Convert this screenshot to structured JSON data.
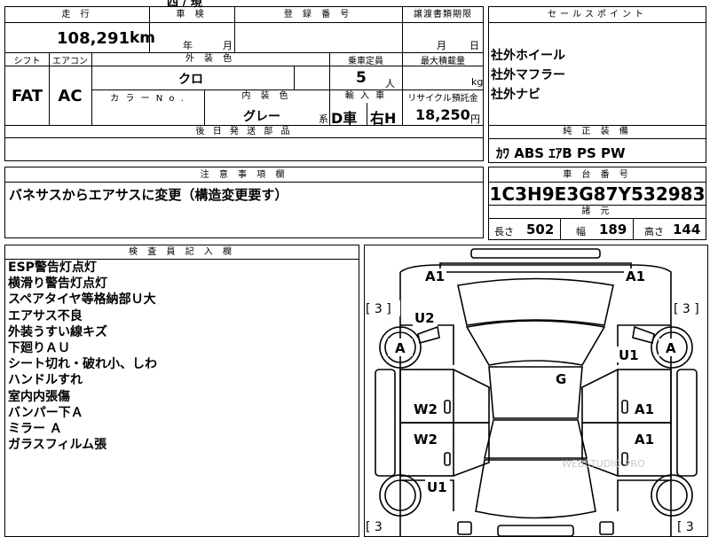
{
  "header": {
    "mileage_label": "走 行",
    "inspection_label": "車 検",
    "registration_label": "登 録 番 号",
    "transfer_label": "譲渡書類期限",
    "sales_point_label": "セールスポイント",
    "top_right_partial": "四 / 現"
  },
  "vehicle": {
    "mileage_value": "108,291",
    "mileage_unit": "km",
    "inspection_year": "年",
    "inspection_month": "月",
    "transfer_month": "月",
    "transfer_day": "日"
  },
  "specs": {
    "shift_label": "シフト",
    "aircon_label": "エアコン",
    "exterior_color_label": "外 装 色",
    "capacity_label": "乗車定員",
    "max_load_label": "最大積載量",
    "shift_value": "FAT",
    "aircon_value": "AC",
    "exterior_color_value": "クロ",
    "capacity_value": "5",
    "capacity_unit": "人",
    "max_load_unit": "kg",
    "color_no_label": "カ ラ ー N o .",
    "interior_color_label": "内 装 色",
    "import_label": "輸 入 車",
    "recycle_label": "リサイクル預託金",
    "interior_color_value": "グレー",
    "interior_color_suffix": "系",
    "import_value_1": "D車",
    "import_value_2": "右H",
    "recycle_value": "18,250",
    "recycle_unit": "円",
    "later_parts_label": "後 日 発 送 部 品"
  },
  "sales_points": {
    "items": [
      "社外ホイール",
      "社外マフラー",
      "社外ナビ"
    ],
    "equipment_label": "純 正 装 備",
    "equipment_value": "ｶﾜ ABS ｴｱB PS PW"
  },
  "notes": {
    "label": "注 意 事 項 欄",
    "text": "バネサスからエアサスに変更（構造変更要す）"
  },
  "chassis": {
    "label": "車 台 番 号",
    "value": "1C3H9E3G87Y532983",
    "dims_label": "諸 元",
    "length_label": "長さ",
    "length_value": "502",
    "width_label": "幅",
    "width_value": "189",
    "height_label": "高さ",
    "height_value": "144"
  },
  "inspector": {
    "label": "検 査 員 記 入 欄",
    "items": [
      "ESP警告灯点灯",
      "横滑り警告灯点灯",
      "スペアタイヤ等格納部Ｕ大",
      "エアサス不良",
      "外装うすい線キズ",
      "下廻りＡＵ",
      "シート切れ・破れ小、しわ",
      "ハンドルすれ",
      "室内内張傷",
      "バンパー下Ａ",
      "ミラー Ａ",
      "ガラスフィルム張"
    ]
  },
  "diagram": {
    "marks": {
      "front_left": "A1",
      "front_right": "A1",
      "left_fender": "U2",
      "tire_left_front": "A",
      "tire_right_front": "A",
      "right_fender": "U1",
      "roof": "G",
      "left_front_door": "W2",
      "right_front_door": "A1",
      "left_rear_door": "W2",
      "right_rear_door": "A1",
      "left_rear_fender": "U1"
    },
    "tread_left_top": "[ 3 ]",
    "tread_right_top": "[ 3 ]",
    "tread_left_bottom": "[ 3",
    "tread_right_bottom": "[ 3",
    "watermark": "WEBSTUDIO PRO"
  }
}
